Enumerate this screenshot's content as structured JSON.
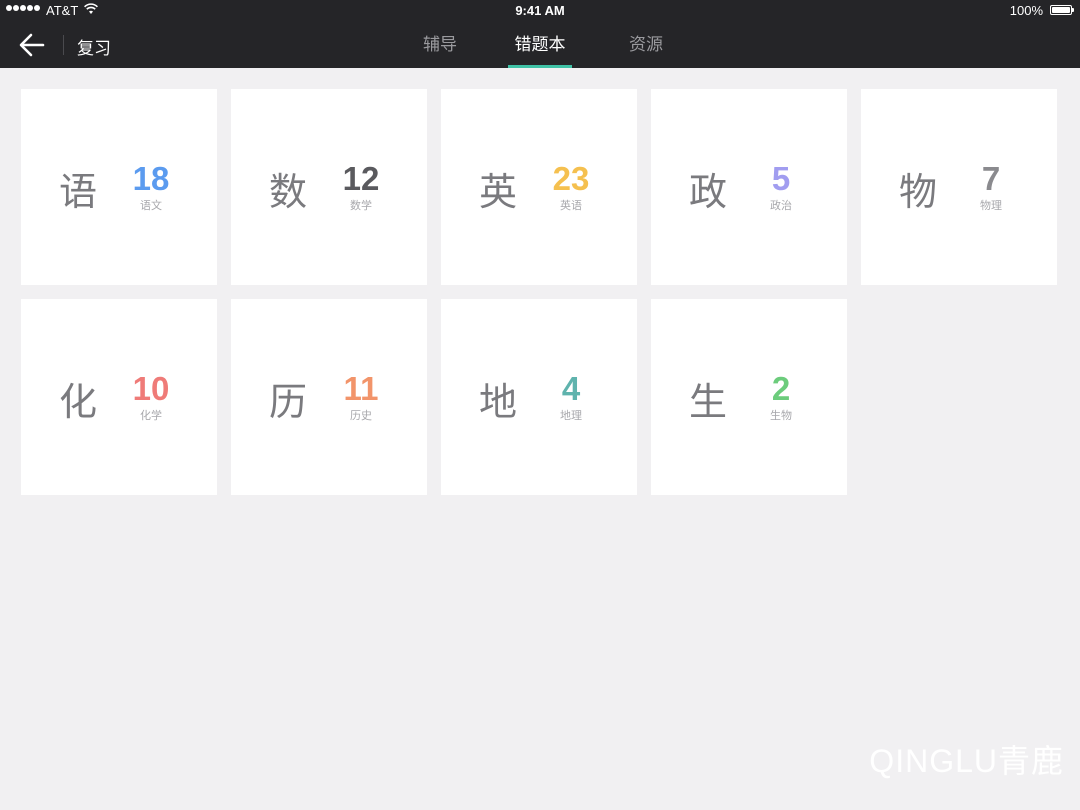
{
  "status_bar": {
    "carrier": "AT&T",
    "time": "9:41 AM",
    "battery": "100%",
    "battery_level": 1.0
  },
  "nav": {
    "back_icon": "arrow-left-icon",
    "title": "复习",
    "tabs": [
      {
        "label": "辅导",
        "active": false
      },
      {
        "label": "错题本",
        "active": true
      },
      {
        "label": "资源",
        "active": false
      }
    ],
    "accent_color": "#3fc2a6"
  },
  "subjects": [
    {
      "char": "语",
      "count": "18",
      "label": "语文",
      "color": "#5b9bef"
    },
    {
      "char": "数",
      "count": "12",
      "label": "数学",
      "color": "#5a5a5e"
    },
    {
      "char": "英",
      "count": "23",
      "label": "英语",
      "color": "#f5c04f"
    },
    {
      "char": "政",
      "count": "5",
      "label": "政治",
      "color": "#a19df0"
    },
    {
      "char": "物",
      "count": "7",
      "label": "物理",
      "color": "#8a8a8e"
    },
    {
      "char": "化",
      "count": "10",
      "label": "化学",
      "color": "#ef7b78"
    },
    {
      "char": "历",
      "count": "11",
      "label": "历史",
      "color": "#f2946a"
    },
    {
      "char": "地",
      "count": "4",
      "label": "地理",
      "color": "#5fb3ad"
    },
    {
      "char": "生",
      "count": "2",
      "label": "生物",
      "color": "#6ccc7c"
    }
  ],
  "watermark": "QINGLU青鹿"
}
